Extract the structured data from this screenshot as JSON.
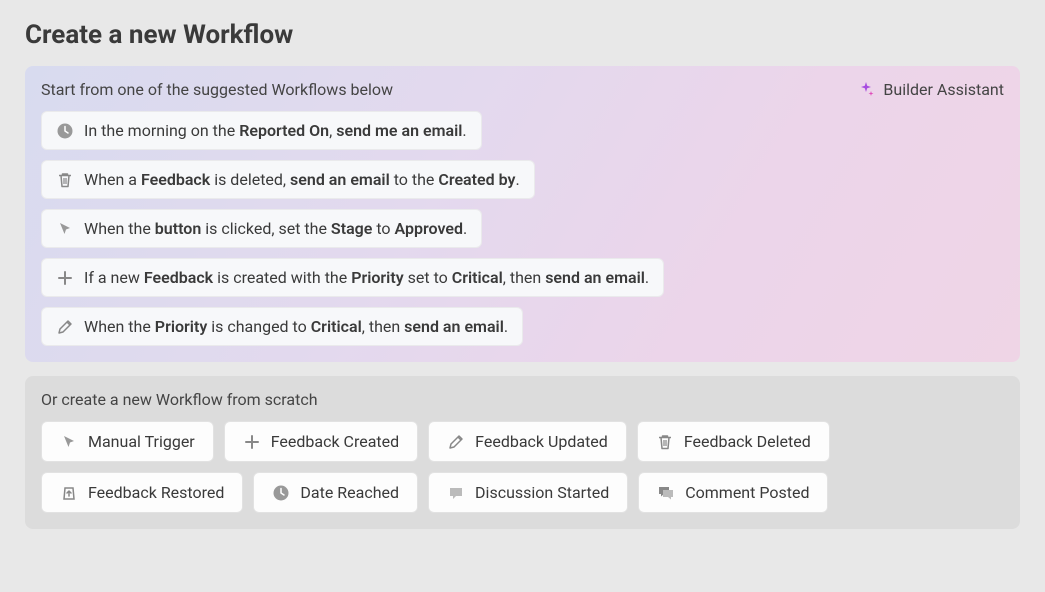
{
  "title": "Create a new Workflow",
  "suggested": {
    "intro": "Start from one of the suggested Workflows below",
    "assistant_label": "Builder Assistant",
    "items": [
      {
        "icon": "clock-icon",
        "segments": [
          {
            "t": "In the morning on the "
          },
          {
            "t": "Reported On",
            "b": true
          },
          {
            "t": ", "
          },
          {
            "t": "send me an email",
            "b": true
          },
          {
            "t": "."
          }
        ]
      },
      {
        "icon": "trash-icon",
        "segments": [
          {
            "t": "When a "
          },
          {
            "t": "Feedback",
            "b": true
          },
          {
            "t": " is deleted, "
          },
          {
            "t": "send an email",
            "b": true
          },
          {
            "t": " to the "
          },
          {
            "t": "Created by",
            "b": true
          },
          {
            "t": "."
          }
        ]
      },
      {
        "icon": "cursor-icon",
        "segments": [
          {
            "t": "When the "
          },
          {
            "t": "button",
            "b": true
          },
          {
            "t": " is clicked, set the "
          },
          {
            "t": "Stage",
            "b": true
          },
          {
            "t": " to "
          },
          {
            "t": "Approved",
            "b": true
          },
          {
            "t": "."
          }
        ]
      },
      {
        "icon": "plus-icon",
        "segments": [
          {
            "t": "If a new "
          },
          {
            "t": "Feedback",
            "b": true
          },
          {
            "t": " is created with the "
          },
          {
            "t": "Priority",
            "b": true
          },
          {
            "t": " set to "
          },
          {
            "t": "Critical",
            "b": true
          },
          {
            "t": ", then "
          },
          {
            "t": "send an email",
            "b": true
          },
          {
            "t": "."
          }
        ]
      },
      {
        "icon": "edit-icon",
        "segments": [
          {
            "t": "When the "
          },
          {
            "t": "Priority",
            "b": true
          },
          {
            "t": " is changed to "
          },
          {
            "t": "Critical",
            "b": true
          },
          {
            "t": ", then "
          },
          {
            "t": "send an email",
            "b": true
          },
          {
            "t": "."
          }
        ]
      }
    ]
  },
  "scratch": {
    "intro": "Or create a new Workflow from scratch",
    "items": [
      {
        "icon": "cursor-icon",
        "label": "Manual Trigger"
      },
      {
        "icon": "plus-icon",
        "label": "Feedback Created"
      },
      {
        "icon": "edit-icon",
        "label": "Feedback Updated"
      },
      {
        "icon": "trash-icon",
        "label": "Feedback Deleted"
      },
      {
        "icon": "restore-icon",
        "label": "Feedback Restored"
      },
      {
        "icon": "clock-icon",
        "label": "Date Reached"
      },
      {
        "icon": "chat-icon",
        "label": "Discussion Started"
      },
      {
        "icon": "comment-icon",
        "label": "Comment Posted"
      }
    ]
  }
}
